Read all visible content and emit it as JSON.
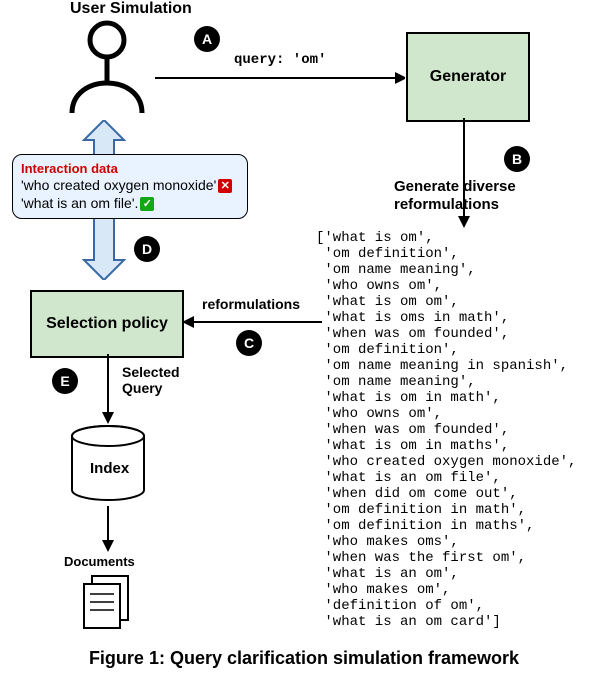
{
  "labels": {
    "user_sim": "User Simulation",
    "query": "query: 'om'",
    "generator": "Generator",
    "generate_reformulations_l1": "Generate diverse",
    "generate_reformulations_l2": "reformulations",
    "interaction_data": "Interaction data",
    "interaction_line1": "'who created oxygen monoxide'",
    "interaction_line2": "'what is an om file'.",
    "selection_policy": "Selection policy",
    "reformulations_arrow": "reformulations",
    "selected_query_l1": "Selected",
    "selected_query_l2": "Query",
    "index": "Index",
    "documents": "Documents",
    "caption": "Figure 1: Query clarification simulation framework"
  },
  "badges": {
    "A": "A",
    "B": "B",
    "C": "C",
    "D": "D",
    "E": "E"
  },
  "reformulations": [
    "'what is om',",
    "'om definition',",
    "'om name meaning',",
    "'who owns om',",
    "'what is om om',",
    "'what is oms in math',",
    "'when was om founded',",
    "'om definition',",
    "'om name meaning in spanish',",
    "'om name meaning',",
    "'what is om in math',",
    "'who owns om',",
    "'when was om founded',",
    "'what is om in maths',",
    "'who created oxygen monoxide',",
    "'what is an om file',",
    "'when did om come out',",
    "'om definition in math',",
    "'om definition in maths',",
    "'who makes oms',",
    "'when was the first om',",
    "'what is an om',",
    "'who makes om',",
    "'definition of om',",
    "'what is an om card']"
  ]
}
